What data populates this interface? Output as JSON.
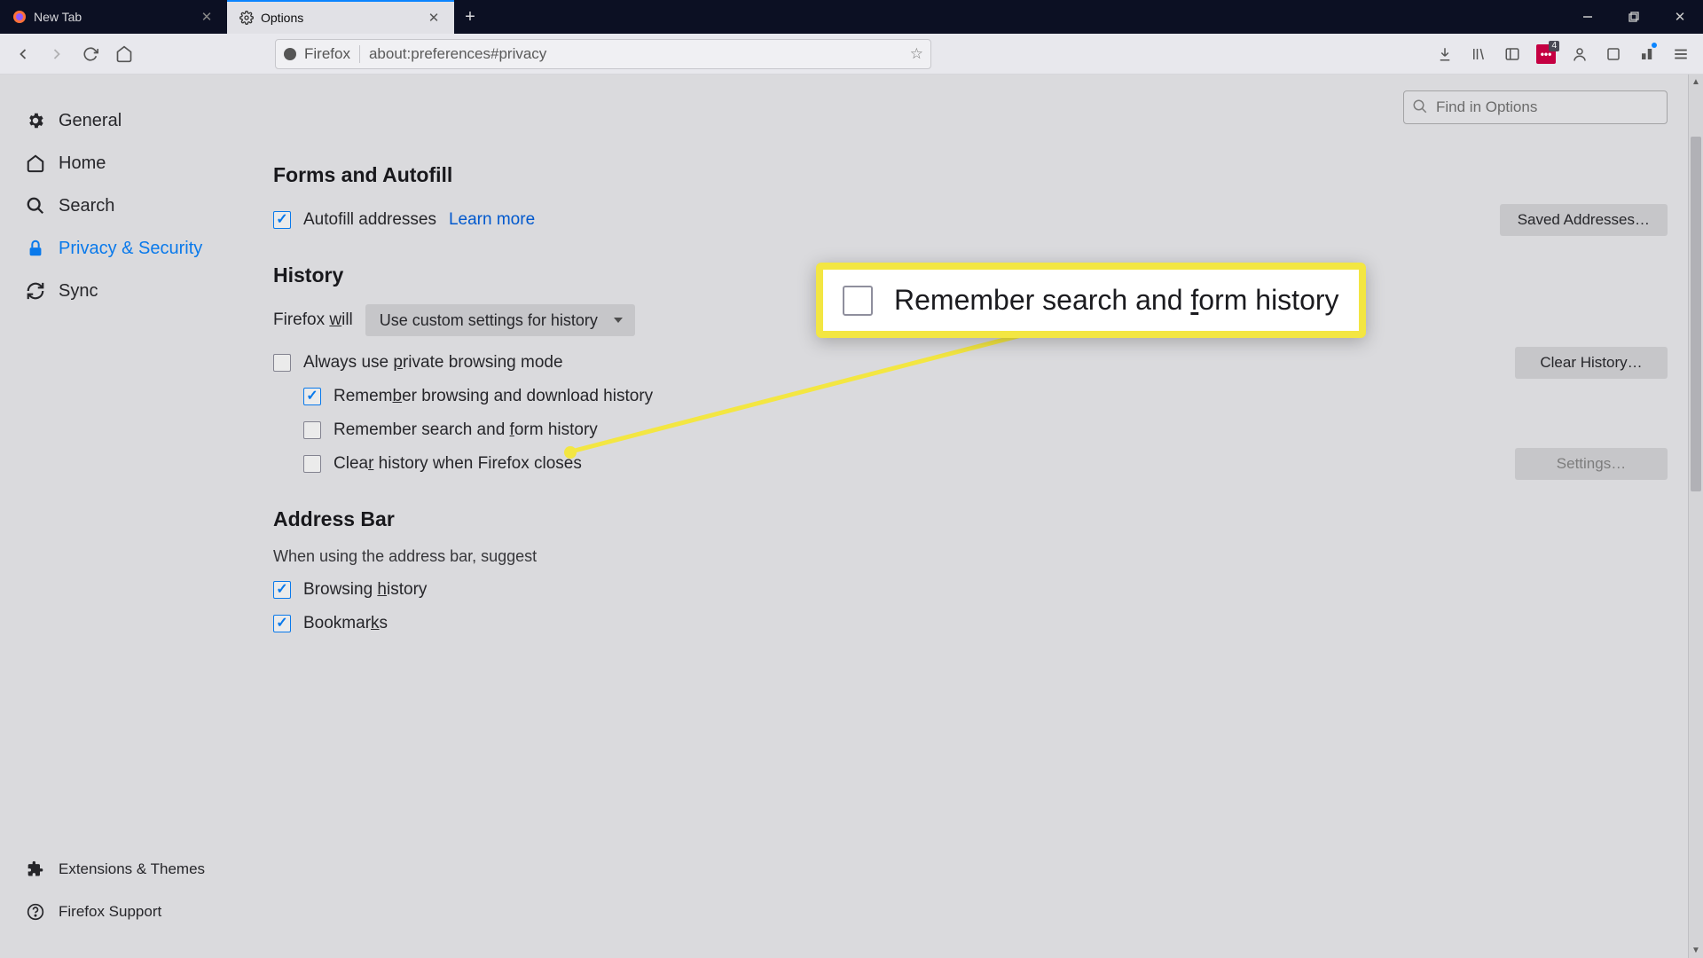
{
  "tabs": [
    {
      "title": "New Tab",
      "active": false
    },
    {
      "title": "Options",
      "active": true
    }
  ],
  "urlbar": {
    "identity_label": "Firefox",
    "url": "about:preferences#privacy"
  },
  "toolbar_badge": "4",
  "find_placeholder": "Find in Options",
  "sidebar": {
    "items": [
      {
        "label": "General",
        "icon": "gear"
      },
      {
        "label": "Home",
        "icon": "home"
      },
      {
        "label": "Search",
        "icon": "search"
      },
      {
        "label": "Privacy & Security",
        "icon": "lock",
        "active": true
      },
      {
        "label": "Sync",
        "icon": "sync"
      }
    ],
    "bottom": [
      {
        "label": "Extensions & Themes",
        "icon": "puzzle"
      },
      {
        "label": "Firefox Support",
        "icon": "help"
      }
    ]
  },
  "sections": {
    "forms": {
      "title": "Forms and Autofill",
      "autofill_label": "Autofill addresses",
      "learn_more": "Learn more",
      "saved_btn": "Saved Addresses…"
    },
    "history": {
      "title": "History",
      "will_label": "Firefox will",
      "select_value": "Use custom settings for history",
      "always_private": "Always use private browsing mode",
      "remember_browse": "Remember browsing and download history",
      "remember_search": "Remember search and form history",
      "clear_close": "Clear history when Firefox closes",
      "clear_btn": "Clear History…",
      "settings_btn": "Settings…"
    },
    "addressbar": {
      "title": "Address Bar",
      "desc": "When using the address bar, suggest",
      "browsing": "Browsing history",
      "bookmarks": "Bookmarks"
    }
  },
  "callout_text": "Remember search and form history"
}
